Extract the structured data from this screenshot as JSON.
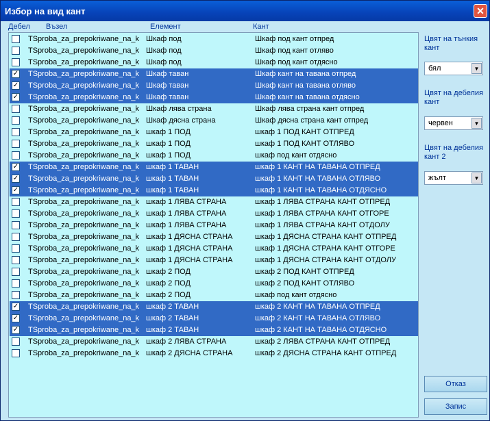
{
  "window": {
    "title": "Избор на вид  кант",
    "close_glyph": "✕"
  },
  "headers": {
    "debel": "Дебел",
    "vazel": "Възел",
    "element": "Елемент",
    "kant": "Кант"
  },
  "rows": [
    {
      "checked": false,
      "selected": false,
      "node": "TSproba_za_prepokriwane_na_ka",
      "element": "Шкаф под",
      "edge": "Шкаф  под кант отпред"
    },
    {
      "checked": false,
      "selected": false,
      "node": "TSproba_za_prepokriwane_na_ka",
      "element": "Шкаф под",
      "edge": "Шкаф под кант отляво"
    },
    {
      "checked": false,
      "selected": false,
      "node": "TSproba_za_prepokriwane_na_ka",
      "element": "Шкаф под",
      "edge": "Шкаф под кант отдясно"
    },
    {
      "checked": true,
      "selected": true,
      "node": "TSproba_za_prepokriwane_na_ka",
      "element": "Шкаф таван",
      "edge": "Шкаф кант на тавана отпред"
    },
    {
      "checked": true,
      "selected": true,
      "node": "TSproba_za_prepokriwane_na_ka",
      "element": "Шкаф таван",
      "edge": "Шкаф кант на тавана отляво"
    },
    {
      "checked": true,
      "selected": true,
      "node": "TSproba_za_prepokriwane_na_ka",
      "element": "Шкаф таван",
      "edge": "Шкаф кант на тавана отдясно"
    },
    {
      "checked": false,
      "selected": false,
      "node": "TSproba_za_prepokriwane_na_ka",
      "element": "Шкаф лява страна",
      "edge": "Шкаф лява страна кант отпред"
    },
    {
      "checked": false,
      "selected": false,
      "node": "TSproba_za_prepokriwane_na_ka",
      "element": "Шкаф дясна страна",
      "edge": "Шкаф дясна страна кант отпред"
    },
    {
      "checked": false,
      "selected": false,
      "node": "TSproba_za_prepokriwane_na_ka",
      "element": "шкаф 1 ПОД",
      "edge": "шкаф 1  ПОД КАНТ ОТПРЕД"
    },
    {
      "checked": false,
      "selected": false,
      "node": "TSproba_za_prepokriwane_na_ka",
      "element": "шкаф 1 ПОД",
      "edge": "шкаф 1 ПОД КАНТ ОТЛЯВО"
    },
    {
      "checked": false,
      "selected": false,
      "node": "TSproba_za_prepokriwane_na_ka",
      "element": "шкаф 1 ПОД",
      "edge": "шкаф под кант отдясно"
    },
    {
      "checked": true,
      "selected": true,
      "node": "TSproba_za_prepokriwane_na_ka",
      "element": "шкаф 1 ТАВАН",
      "edge": "шкаф 1 КАНТ НА ТАВАНА ОТПРЕД"
    },
    {
      "checked": true,
      "selected": true,
      "node": "TSproba_za_prepokriwane_na_ka",
      "element": "шкаф 1 ТАВАН",
      "edge": "шкаф 1 КАНТ НА ТАВАНА ОТЛЯВО"
    },
    {
      "checked": true,
      "selected": true,
      "node": "TSproba_za_prepokriwane_na_ka",
      "element": "шкаф 1 ТАВАН",
      "edge": "шкаф 1 КАНТ НА ТАВАНА ОТДЯСНО"
    },
    {
      "checked": false,
      "selected": false,
      "node": "TSproba_za_prepokriwane_na_ka",
      "element": "шкаф 1 ЛЯВА СТРАНА",
      "edge": "шкаф 1 ЛЯВА СТРАНА КАНТ ОТПРЕД"
    },
    {
      "checked": false,
      "selected": false,
      "node": "TSproba_za_prepokriwane_na_ka",
      "element": "шкаф 1 ЛЯВА СТРАНА",
      "edge": "шкаф 1 ЛЯВА СТРАНА КАНТ ОТГОРЕ"
    },
    {
      "checked": false,
      "selected": false,
      "node": "TSproba_za_prepokriwane_na_ka",
      "element": "шкаф 1 ЛЯВА СТРАНА",
      "edge": "шкаф 1 ЛЯВА СТРАНА КАНТ ОТДОЛУ"
    },
    {
      "checked": false,
      "selected": false,
      "node": "TSproba_za_prepokriwane_na_ka",
      "element": "шкаф 1 ДЯСНА СТРАНА",
      "edge": "шкаф 1 ДЯСНА СТРАНА КАНТ ОТПРЕД"
    },
    {
      "checked": false,
      "selected": false,
      "node": "TSproba_za_prepokriwane_na_ka",
      "element": "шкаф 1 ДЯСНА СТРАНА",
      "edge": "шкаф 1 ДЯСНА СТРАНА КАНТ ОТГОРЕ"
    },
    {
      "checked": false,
      "selected": false,
      "node": "TSproba_za_prepokriwane_na_ka",
      "element": "шкаф 1 ДЯСНА СТРАНА",
      "edge": "шкаф 1 ДЯСНА СТРАНА КАНТ ОТДОЛУ"
    },
    {
      "checked": false,
      "selected": false,
      "node": "TSproba_za_prepokriwane_na_ka",
      "element": "шкаф  2 ПОД",
      "edge": "шкаф  2  ПОД КАНТ ОТПРЕД"
    },
    {
      "checked": false,
      "selected": false,
      "node": "TSproba_za_prepokriwane_na_ka",
      "element": "шкаф  2 ПОД",
      "edge": "шкаф  2 ПОД КАНТ ОТЛЯВО"
    },
    {
      "checked": false,
      "selected": false,
      "node": "TSproba_za_prepokriwane_na_ka",
      "element": "шкаф  2 ПОД",
      "edge": "шкаф под кант отдясно"
    },
    {
      "checked": true,
      "selected": true,
      "node": "TSproba_za_prepokriwane_na_ka",
      "element": "шкаф  2 ТАВАН",
      "edge": "шкаф  2 КАНТ НА ТАВАНА ОТПРЕД"
    },
    {
      "checked": true,
      "selected": true,
      "node": "TSproba_za_prepokriwane_na_ka",
      "element": "шкаф  2 ТАВАН",
      "edge": "шкаф  2 КАНТ НА ТАВАНА ОТЛЯВО"
    },
    {
      "checked": true,
      "selected": true,
      "node": "TSproba_za_prepokriwane_na_ka",
      "element": "шкаф  2 ТАВАН",
      "edge": "шкаф  2 КАНТ НА ТАВАНА ОТДЯСНО"
    },
    {
      "checked": false,
      "selected": false,
      "node": "TSproba_za_prepokriwane_na_ka",
      "element": "шкаф  2 ЛЯВА СТРАНА",
      "edge": "шкаф  2 ЛЯВА СТРАНА КАНТ ОТПРЕД"
    },
    {
      "checked": false,
      "selected": false,
      "node": "TSproba_za_prepokriwane_na_ka",
      "element": "шкаф  2 ДЯСНА СТРАНА",
      "edge": "шкаф  2 ДЯСНА СТРАНА КАНТ ОТПРЕД"
    }
  ],
  "sidebar": {
    "thin_label": "Цвят на тънкия кант",
    "thin_value": "бял",
    "thick_label": "Цвят на дебелия кант",
    "thick_value": "червен",
    "thick2_label": "Цвят на дебелия кант 2",
    "thick2_value": "жълт",
    "dropdown_glyph": "▼"
  },
  "buttons": {
    "cancel": "Отказ",
    "save": "Запис"
  },
  "check_glyph": "✓",
  "colors": {
    "selection": "#316ac5",
    "list_bg": "#bff7fb",
    "label": "#003399"
  }
}
